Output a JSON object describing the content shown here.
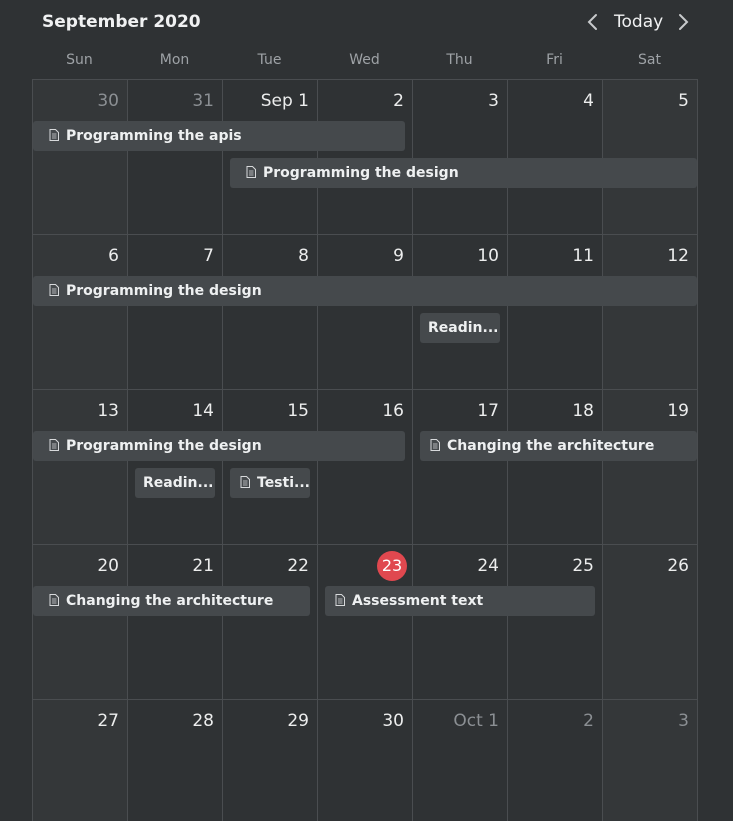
{
  "header": {
    "month_title": "September 2020",
    "today_label": "Today"
  },
  "weekdays": [
    "Sun",
    "Mon",
    "Tue",
    "Wed",
    "Thu",
    "Fri",
    "Sat"
  ],
  "weeks": [
    [
      "30",
      "31",
      "Sep 1",
      "2",
      "3",
      "4",
      "5"
    ],
    [
      "6",
      "7",
      "8",
      "9",
      "10",
      "11",
      "12"
    ],
    [
      "13",
      "14",
      "15",
      "16",
      "17",
      "18",
      "19"
    ],
    [
      "20",
      "21",
      "22",
      "23",
      "24",
      "25",
      "26"
    ],
    [
      "27",
      "28",
      "29",
      "30",
      "Oct 1",
      "2",
      "3"
    ]
  ],
  "events": {
    "w0_apis": "Programming the apis",
    "w0_design": "Programming the design",
    "w1_design": "Programming the design",
    "w1_reading": "Readin...",
    "w2_design": "Programming the design",
    "w2_arch": "Changing the architecture",
    "w2_reading": "Readin...",
    "w2_testing": "Testi...",
    "w3_arch": "Changing the architecture",
    "w3_assessment": "Assessment text"
  },
  "colors": {
    "background": "#2f3234",
    "event": "#45494c",
    "today": "#e0484f"
  }
}
